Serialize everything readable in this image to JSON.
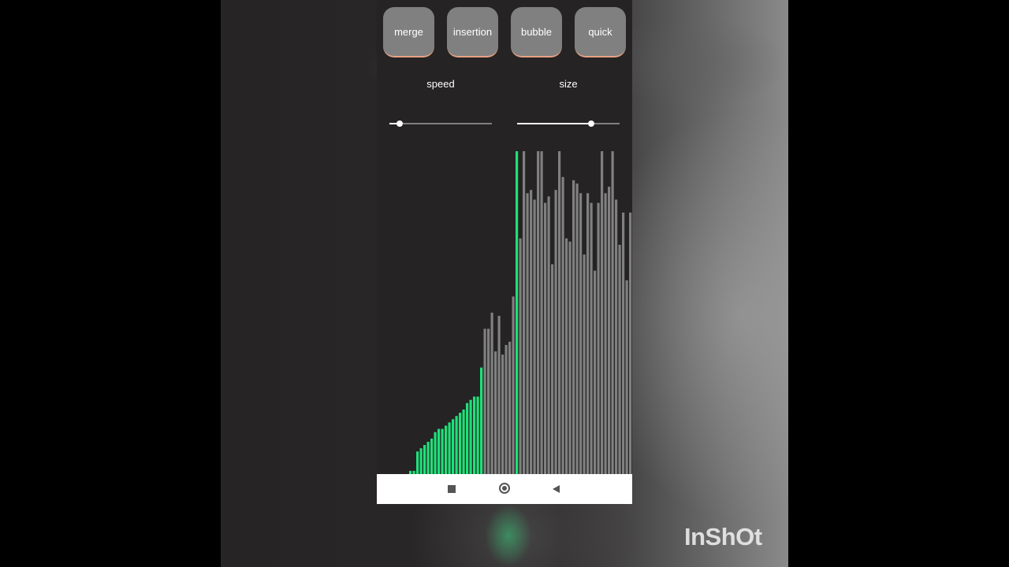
{
  "buttons": [
    {
      "label": "merge"
    },
    {
      "label": "insertion"
    },
    {
      "label": "bubble"
    },
    {
      "label": "quick"
    }
  ],
  "sliders": {
    "speed": {
      "label": "speed",
      "value": 0.1
    },
    "size": {
      "label": "size",
      "value": 0.72
    }
  },
  "chart_data": {
    "type": "bar",
    "values": [
      0,
      0,
      0,
      0,
      0,
      0,
      1,
      1,
      7,
      8,
      9,
      10,
      11,
      13,
      14,
      14,
      15,
      16,
      17,
      18,
      19,
      20,
      22,
      23,
      24,
      24,
      33,
      45,
      45,
      50,
      38,
      49,
      37,
      40,
      41,
      55,
      100,
      73,
      100,
      87,
      88,
      85,
      100,
      100,
      84,
      86,
      65,
      88,
      100,
      92,
      73,
      72,
      91,
      90,
      87,
      68,
      87,
      84,
      63,
      84,
      100,
      87,
      89,
      100,
      85,
      71,
      81,
      60,
      81
    ],
    "sorted_count": 27,
    "active_index": 36,
    "colors": {
      "sorted": "#1fe07a",
      "unsorted": "#808080",
      "active": "#1fe07a"
    }
  },
  "watermark": "InShOt"
}
